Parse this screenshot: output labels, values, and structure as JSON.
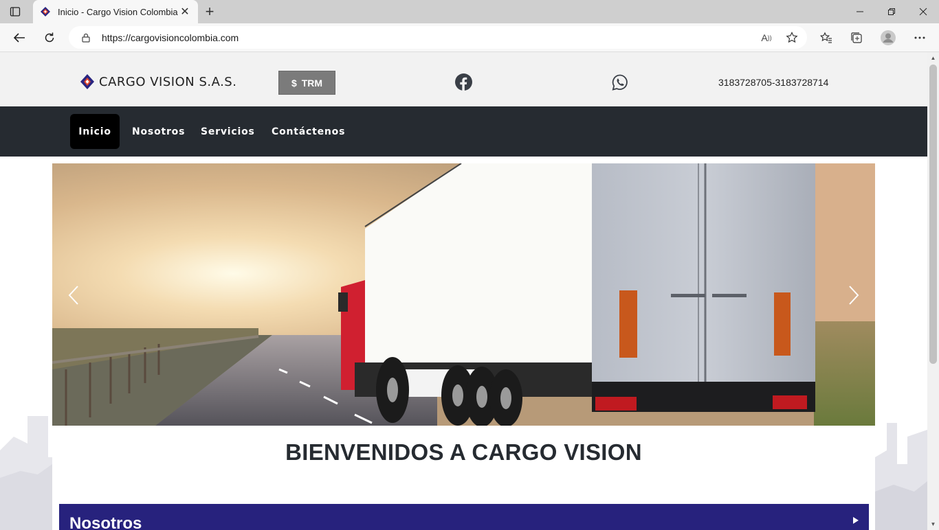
{
  "browser": {
    "tab_title": "Inicio - Cargo Vision Colombia",
    "url": "https://cargovisioncolombia.com"
  },
  "header": {
    "logo_text": "CARGO VISION S.A.S.",
    "trm_symbol": "$",
    "trm_label": "TRM",
    "phones": "3183728705-3183728714"
  },
  "nav": {
    "items": [
      {
        "label": "Inicio",
        "active": true
      },
      {
        "label": "Nosotros",
        "active": false
      },
      {
        "label": "Servicios",
        "active": false
      },
      {
        "label": "Contáctenos",
        "active": false
      }
    ]
  },
  "carousel": {
    "prev_icon": "chevron-left-icon",
    "next_icon": "chevron-right-icon"
  },
  "welcome": {
    "heading": "BIENVENIDOS A CARGO VISION"
  },
  "accordion": {
    "label": "Nosotros",
    "icon": "caret-right-icon"
  },
  "colors": {
    "nav_bg": "#262b31",
    "accordion_bg": "#27227d",
    "trm_bg": "#7b7b7b"
  }
}
